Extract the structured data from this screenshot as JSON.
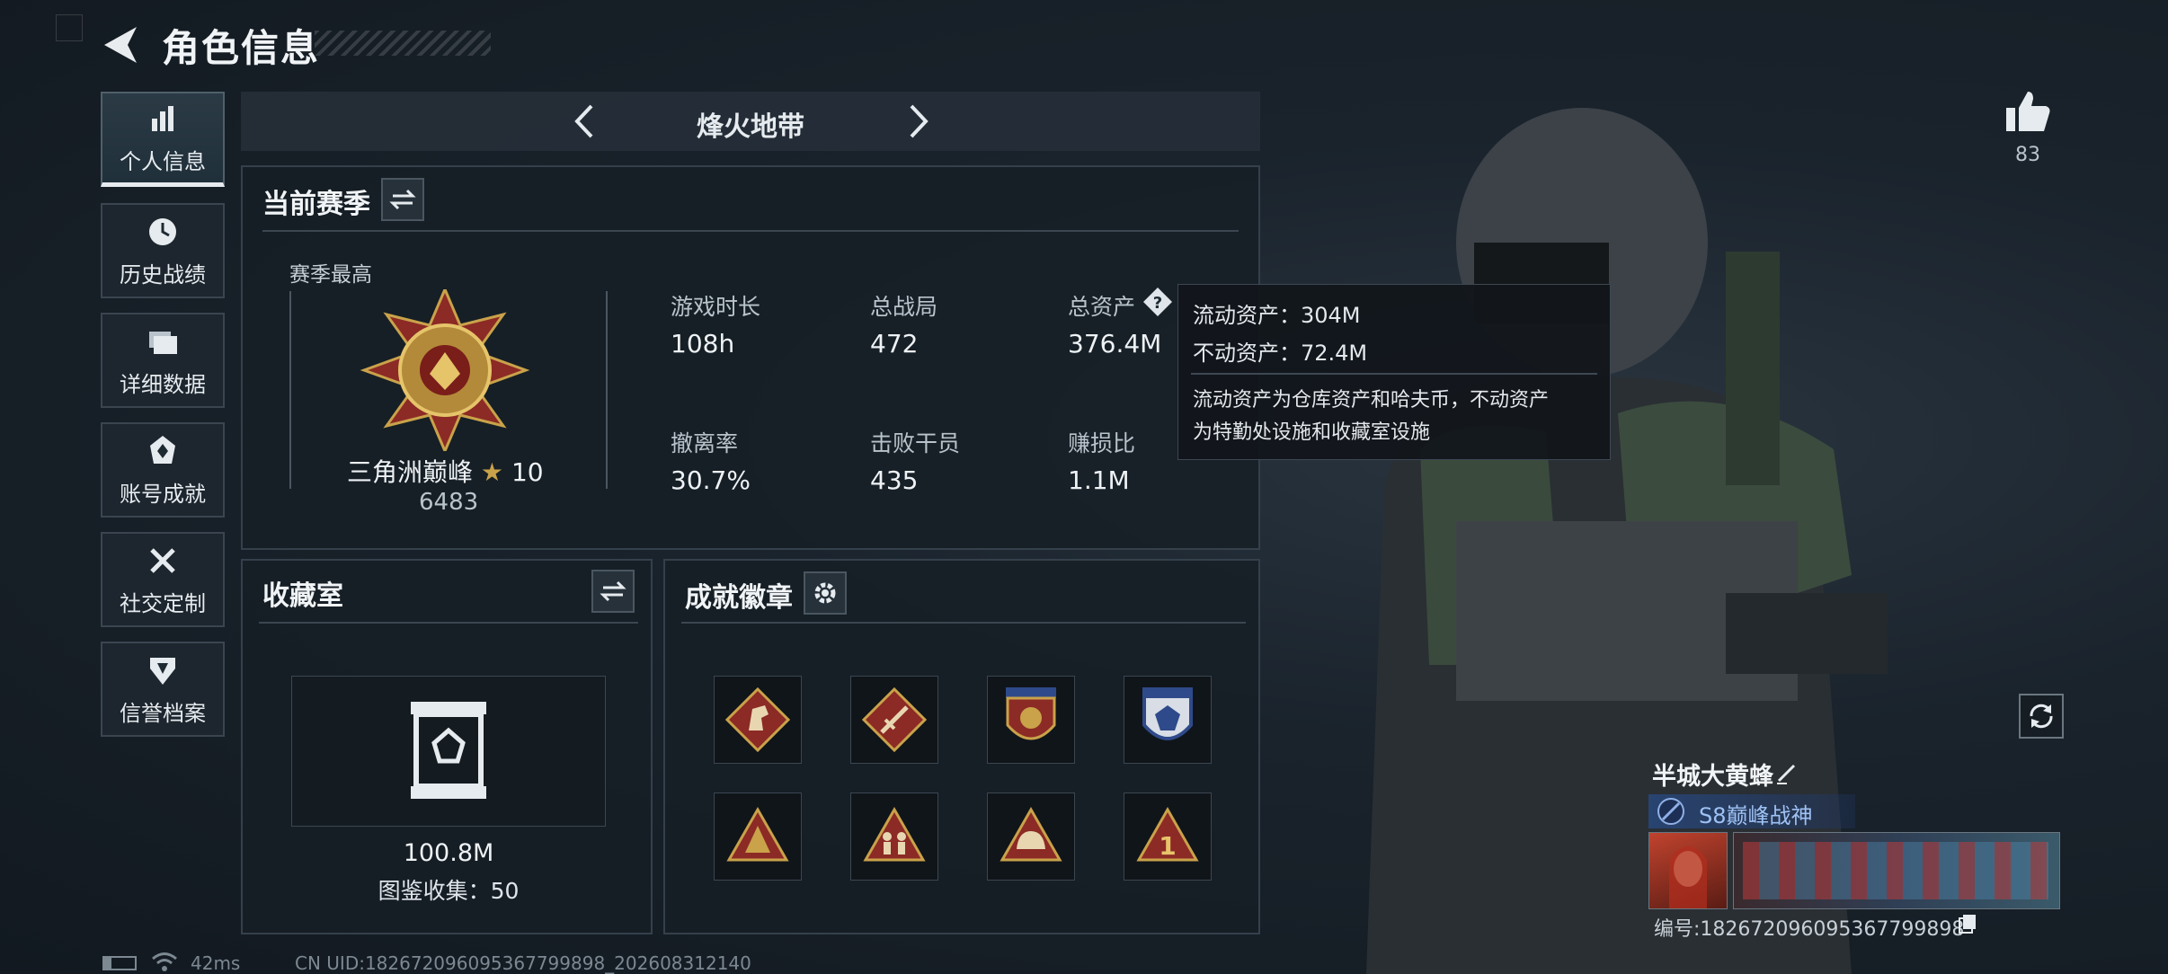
{
  "header": {
    "title": "角色信息"
  },
  "sidebar": {
    "items": [
      {
        "label": "个人信息",
        "icon": "bar-chart-icon",
        "active": true
      },
      {
        "label": "历史战绩",
        "icon": "history-icon"
      },
      {
        "label": "详细数据",
        "icon": "folder-icon"
      },
      {
        "label": "账号成就",
        "icon": "achievement-icon"
      },
      {
        "label": "社交定制",
        "icon": "tools-icon"
      },
      {
        "label": "信誉档案",
        "icon": "credit-shield-icon"
      }
    ]
  },
  "mode_selector": {
    "title": "烽火地带"
  },
  "season": {
    "title": "当前赛季",
    "best_label": "赛季最高",
    "rank_name": "三角洲巅峰",
    "rank_stars": "10",
    "rank_score": "6483",
    "stats": [
      {
        "label": "游戏时长",
        "value": "108h"
      },
      {
        "label": "总战局",
        "value": "472"
      },
      {
        "label": "总资产",
        "value": "376.4M"
      },
      {
        "label": "撤离率",
        "value": "30.7%"
      },
      {
        "label": "击败干员",
        "value": "435"
      },
      {
        "label": "赚损比",
        "value": "1.1M"
      }
    ]
  },
  "tooltip": {
    "line1": "流动资产：304M",
    "line2": "不动资产：72.4M",
    "desc1": "流动资产为仓库资产和哈夫币，不动资产",
    "desc2": "为特勤处设施和收藏室设施"
  },
  "collection": {
    "title": "收藏室",
    "value": "100.8M",
    "count_text": "图鉴收集：50"
  },
  "achievements": {
    "title": "成就徽章",
    "badges": [
      "horse-badge-icon",
      "sword-badge-icon",
      "crest-badge-icon",
      "eagle-shield-badge-icon",
      "triangle-badge-icon",
      "soldiers-badge-icon",
      "helmet-badge-icon",
      "number-one-badge-icon"
    ]
  },
  "likes": {
    "count": "83"
  },
  "profile": {
    "name": "半城大黄蜂",
    "title_badge": "S8巅峰战神",
    "id_text": "编号:182672096095367799898"
  },
  "status_bar": {
    "ping": "42ms",
    "uid": "CN UID:182672096095367799898_202608312140"
  },
  "colors": {
    "accent": "#e6ebef",
    "panel_bg": "#161e26",
    "badge_red": "#8c2a25",
    "gold": "#c9a24a"
  }
}
